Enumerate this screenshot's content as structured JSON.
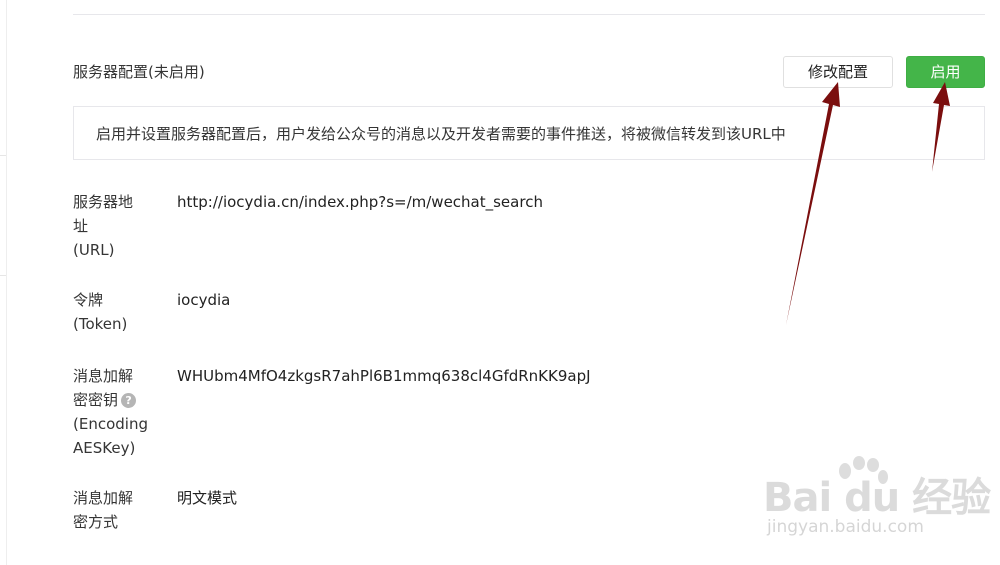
{
  "section": {
    "title": "服务器配置(未启用)"
  },
  "buttons": {
    "modify_label": "修改配置",
    "enable_label": "启用"
  },
  "info": {
    "text": "启用并设置服务器配置后，用户发给公众号的消息以及开发者需要的事件推送，将被微信转发到该URL中"
  },
  "fields": [
    {
      "label_lines": [
        "服务器地",
        "址",
        "(URL)"
      ],
      "value": "http://iocydia.cn/index.php?s=/m/wechat_search"
    },
    {
      "label_lines": [
        "令牌",
        "(Token)"
      ],
      "value": "iocydia"
    },
    {
      "label_lines": [
        "消息加解",
        "密密钥",
        "(Encoding",
        "AESKey)"
      ],
      "value": "WHUbm4MfO4zkgsR7ahPl6B1mmq638cl4GfdRnKK9apJ"
    },
    {
      "label_lines": [
        "消息加解",
        "密方式"
      ],
      "value": "明文模式"
    }
  ],
  "help_icon": {
    "glyph": "?"
  },
  "watermark": {
    "brand": "Bai du 经验",
    "url": "jingyan.baidu.com"
  },
  "colors": {
    "primary_green": "#44b549",
    "annotation_arrow": "#7b0e0e",
    "border": "#e7e7eb"
  }
}
